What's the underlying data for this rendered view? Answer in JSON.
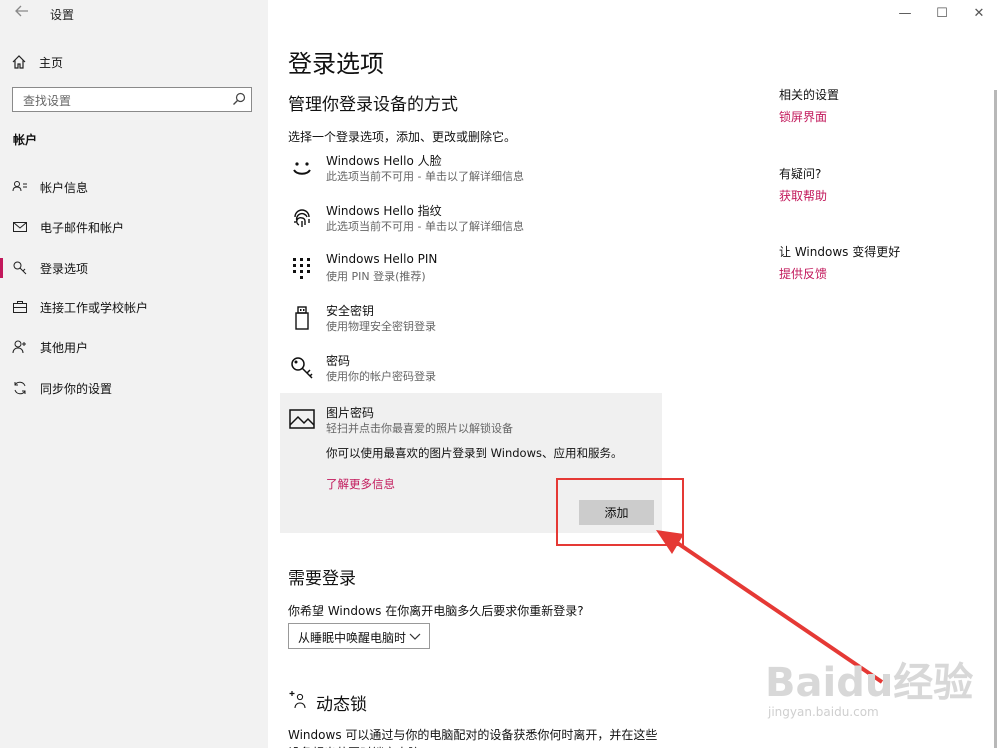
{
  "window": {
    "title": "设置",
    "controls": {
      "minimize": "—",
      "maximize": "☐",
      "close": "✕"
    }
  },
  "sidebar": {
    "home_label": "主页",
    "search_placeholder": "查找设置",
    "section_title": "帐户",
    "items": [
      {
        "label": "帐户信息",
        "icon": "person-card-icon",
        "active": false
      },
      {
        "label": "电子邮件和帐户",
        "icon": "envelope-icon",
        "active": false
      },
      {
        "label": "登录选项",
        "icon": "key-icon",
        "active": true
      },
      {
        "label": "连接工作或学校帐户",
        "icon": "briefcase-icon",
        "active": false
      },
      {
        "label": "其他用户",
        "icon": "person-add-icon",
        "active": false
      },
      {
        "label": "同步你的设置",
        "icon": "sync-icon",
        "active": false
      }
    ]
  },
  "main": {
    "title": "登录选项",
    "subtitle": "管理你登录设备的方式",
    "instruction": "选择一个登录选项，添加、更改或删除它。",
    "options": [
      {
        "name": "Windows Hello 人脸",
        "desc": "此选项当前不可用 - 单击以了解详细信息",
        "icon": "face-icon"
      },
      {
        "name": "Windows Hello 指纹",
        "desc": "此选项当前不可用 - 单击以了解详细信息",
        "icon": "fingerprint-icon"
      },
      {
        "name": "Windows Hello PIN",
        "desc": "使用 PIN 登录(推荐)",
        "icon": "pin-keypad-icon"
      },
      {
        "name": "安全密钥",
        "desc": "使用物理安全密钥登录",
        "icon": "usb-key-icon"
      },
      {
        "name": "密码",
        "desc": "使用你的帐户密码登录",
        "icon": "key-icon"
      },
      {
        "name": "图片密码",
        "desc": "轻扫并点击你最喜爱的照片以解锁设备",
        "icon": "picture-icon"
      }
    ],
    "picture_panel": {
      "description": "你可以使用最喜欢的图片登录到 Windows、应用和服务。",
      "link": "了解更多信息",
      "add_button": "添加"
    },
    "require_signin": {
      "heading": "需要登录",
      "question": "你希望 Windows 在你离开电脑多久后要求你重新登录?",
      "dropdown_value": "从睡眠中唤醒电脑时"
    },
    "dynamic_lock": {
      "heading": "动态锁",
      "text": "Windows 可以通过与你的电脑配对的设备获悉你何时离开，并在这些设备超出范围时锁定电脑。"
    }
  },
  "right": {
    "related_heading": "相关的设置",
    "related_link": "锁屏界面",
    "question_heading": "有疑问?",
    "question_link": "获取帮助",
    "improve_heading": "让 Windows 变得更好",
    "improve_link": "提供反馈"
  },
  "watermark": {
    "brand": "Baidu经验",
    "url": "jingyan.baidu.com"
  },
  "colors": {
    "accent": "#c2185b",
    "highlight": "#e53935",
    "sidebar_bg": "#f2f2f2"
  }
}
